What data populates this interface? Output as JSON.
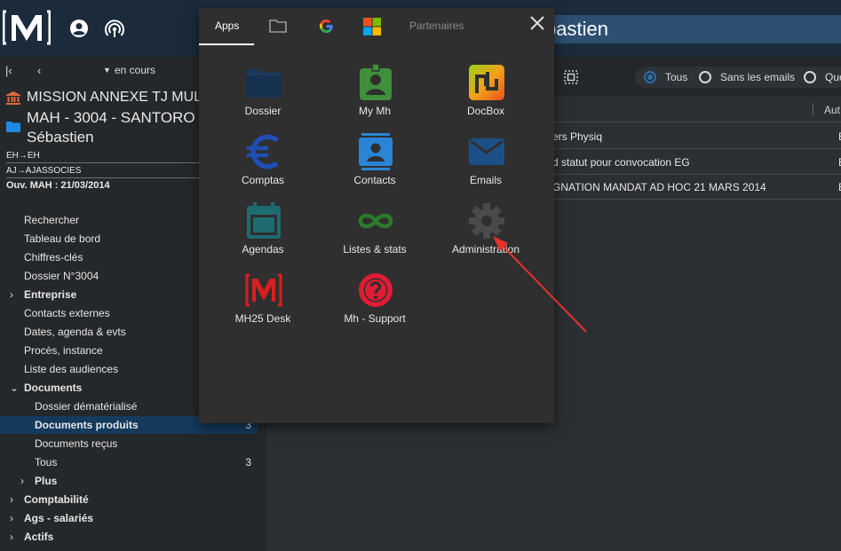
{
  "header": {
    "title_fragment": "bastien"
  },
  "sidebar": {
    "period_label": "en cours",
    "case_org": "MISSION ANNEXE TJ MULHOUSE",
    "case_name": "MAH - 3004 - SANTORO Sébastien",
    "line1": "EH→EH",
    "line2": "AJ→AJASSOCIES",
    "opened": "Ouv. MAH : 21/03/2014",
    "menu": [
      {
        "label": "Rechercher"
      },
      {
        "label": "Tableau de bord"
      },
      {
        "label": "Chiffres-clés"
      },
      {
        "label": "Dossier N°3004"
      },
      {
        "label": "Entreprise",
        "chevron": "›"
      },
      {
        "label": "Contacts externes"
      },
      {
        "label": "Dates, agenda & evts"
      },
      {
        "label": "Procès, instance"
      },
      {
        "label": "Liste des audiences"
      },
      {
        "label": "Documents",
        "chevron": "⌄"
      },
      {
        "label": "Dossier dématérialisé"
      },
      {
        "label": "Documents produits",
        "count": "3"
      },
      {
        "label": "Documents reçus"
      },
      {
        "label": "Tous",
        "count": "3"
      },
      {
        "label": "Plus",
        "chevron": "›"
      },
      {
        "label": "Comptabilité",
        "chevron": "›"
      },
      {
        "label": "Ags - salariés",
        "chevron": "›"
      },
      {
        "label": "Actifs",
        "chevron": "›"
      }
    ]
  },
  "main": {
    "filters": [
      {
        "label": "Tous",
        "checked": true
      },
      {
        "label": "Sans les emails",
        "checked": false
      },
      {
        "label": "Que",
        "checked": false
      }
    ],
    "column_aut": "Aut",
    "rows": [
      {
        "text": "ers Physiq",
        "author": "E"
      },
      {
        "text": "d statut pour convocation EG",
        "author": "E"
      },
      {
        "text": "GNATION MANDAT AD HOC 21 MARS 2014",
        "author": "E"
      }
    ]
  },
  "popup": {
    "tabs": {
      "apps": "Apps",
      "folder": "folder-icon",
      "google": "google-icon",
      "microsoft": "microsoft-icon",
      "partners": "Partenaires"
    },
    "apps": [
      {
        "label": "Dossier",
        "icon": "folder-icon"
      },
      {
        "label": "My Mh",
        "icon": "badge-icon"
      },
      {
        "label": "DocBox",
        "icon": "docbox-icon"
      },
      {
        "label": "Comptas",
        "icon": "euro-icon"
      },
      {
        "label": "Contacts",
        "icon": "contacts-icon"
      },
      {
        "label": "Emails",
        "icon": "mail-icon"
      },
      {
        "label": "Agendas",
        "icon": "calendar-icon"
      },
      {
        "label": "Listes & stats",
        "icon": "infinity-icon"
      },
      {
        "label": "Administration",
        "icon": "gear-icon"
      },
      {
        "label": "MH25 Desk",
        "icon": "mh25-logo-icon"
      },
      {
        "label": "Mh - Support",
        "icon": "help-icon"
      }
    ]
  },
  "colors": {
    "topbar": "#1b2b3c",
    "accent": "#2a6db0",
    "popup": "#2f2f2f",
    "arrow": "#e8312b"
  }
}
